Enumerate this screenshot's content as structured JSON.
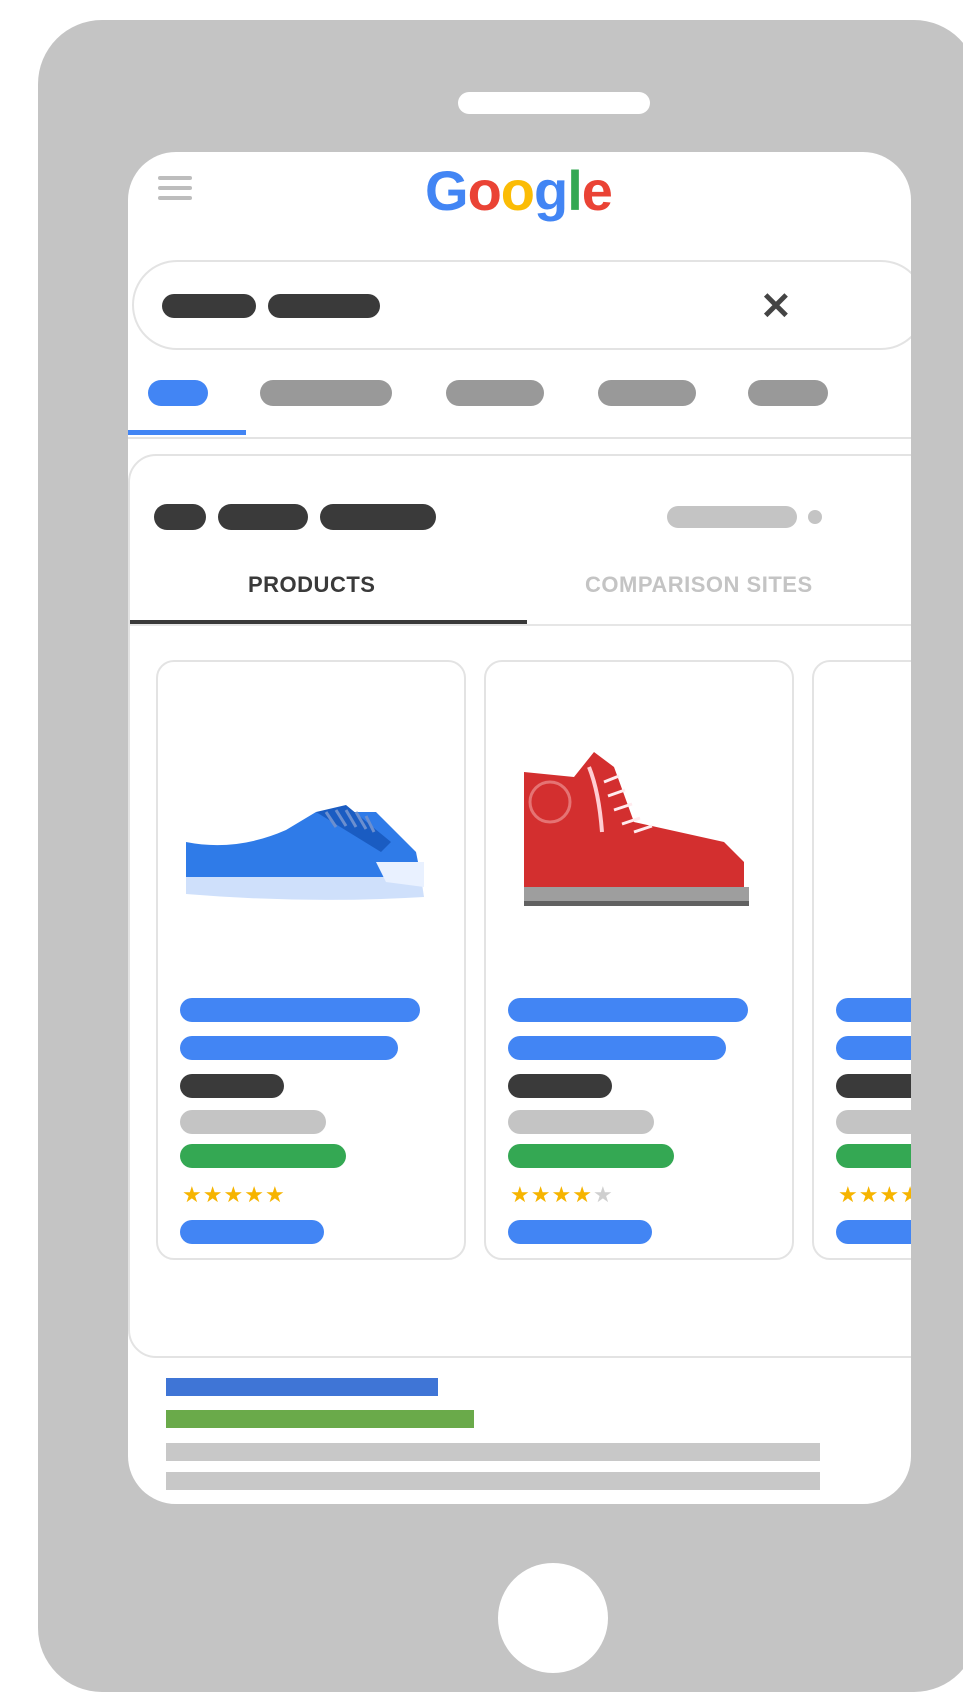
{
  "logo": {
    "letters": [
      {
        "ch": "G",
        "color": "#4285f4"
      },
      {
        "ch": "o",
        "color": "#ea4335"
      },
      {
        "ch": "o",
        "color": "#fbbc05"
      },
      {
        "ch": "g",
        "color": "#4285f4"
      },
      {
        "ch": "l",
        "color": "#34a853"
      },
      {
        "ch": "e",
        "color": "#ea4335"
      }
    ]
  },
  "search": {
    "clear_symbol": "✕"
  },
  "shopping": {
    "tabs": {
      "products": "PRODUCTS",
      "comparison": "COMPARISON SITES"
    },
    "products": [
      {
        "name": "blue-sneaker",
        "rating": 5,
        "max_rating": 5
      },
      {
        "name": "red-high-top",
        "rating": 4,
        "max_rating": 5
      }
    ]
  },
  "colors": {
    "link_blue": "#4285f4",
    "url_green": "#34a853",
    "text_dark": "#3a3a3a",
    "placeholder_gray": "#c4c4c4",
    "star": "#f6b400"
  }
}
